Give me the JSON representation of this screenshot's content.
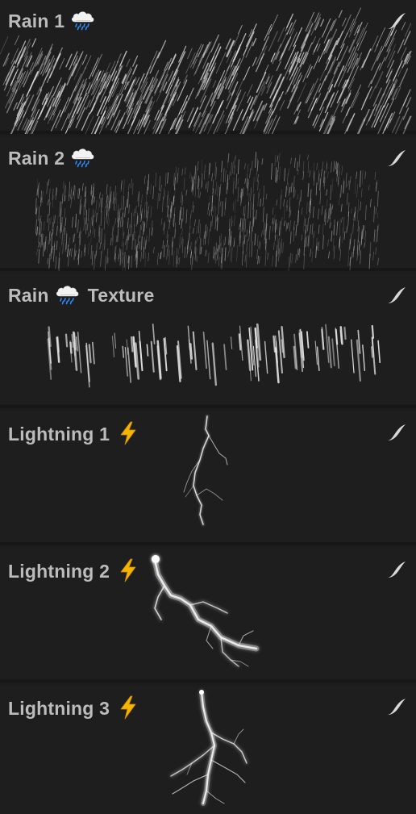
{
  "brushes": [
    {
      "id": "rain-1",
      "name": "Rain 1",
      "decoration": "cloud-with-rain-icon",
      "preview": "rain-dense"
    },
    {
      "id": "rain-2",
      "name": "Rain 2",
      "decoration": "cloud-with-rain-icon",
      "preview": "rain-fine"
    },
    {
      "id": "rain-texture",
      "name_prefix": "Rain",
      "name_suffix": "Texture",
      "decoration": "cloud-with-rain-icon",
      "preview": "rain-streaks"
    },
    {
      "id": "lightning-1",
      "name": "Lightning 1",
      "decoration": "high-voltage-icon",
      "preview": "lightning-thin"
    },
    {
      "id": "lightning-2",
      "name": "Lightning 2",
      "decoration": "high-voltage-icon",
      "preview": "lightning-glow"
    },
    {
      "id": "lightning-3",
      "name": "Lightning 3",
      "decoration": "high-voltage-icon",
      "preview": "lightning-forked"
    }
  ],
  "stroke_icon": "brush-stroke-icon",
  "colors": {
    "background": "#1e1e1e",
    "separator": "#171717",
    "label": "#bcbcbc",
    "preview_stroke": "#e6e6e6",
    "bolt_yellow": "#f5b400"
  }
}
